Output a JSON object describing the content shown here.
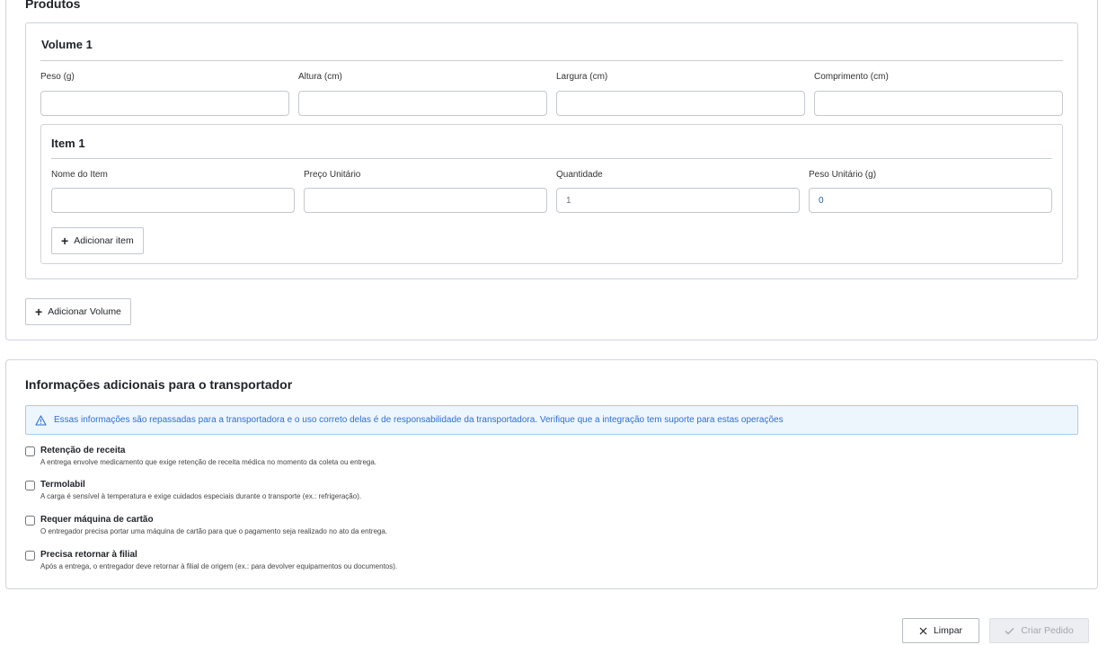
{
  "produtos": {
    "title": "Produtos",
    "volume": {
      "title": "Volume 1",
      "fields": [
        {
          "label": "Peso (g)",
          "value": ""
        },
        {
          "label": "Altura (cm)",
          "value": ""
        },
        {
          "label": "Largura (cm)",
          "value": ""
        },
        {
          "label": "Comprimento (cm)",
          "value": ""
        }
      ],
      "item": {
        "title": "Item 1",
        "fields": [
          {
            "label": "Nome do Item",
            "value": ""
          },
          {
            "label": "Preço Unitário",
            "value": ""
          },
          {
            "label": "Quantidade",
            "value": "1"
          },
          {
            "label": "Peso Unitário (g)",
            "value": "0"
          }
        ],
        "add_item_label": "Adicionar item"
      }
    },
    "add_volume_label": "Adicionar Volume"
  },
  "info": {
    "title": "Informações adicionais para o transportador",
    "alert_text": "Essas informações são repassadas para a transportadora e o uso correto delas é de responsabilidade da transportadora. Verifique que a integração tem suporte para estas operações",
    "options": [
      {
        "title": "Retenção de receita",
        "description": "A entrega envolve medicamento que exige retenção de receita médica no momento da coleta ou entrega.",
        "checked": false
      },
      {
        "title": "Termolabil",
        "description": "A carga é sensível à temperatura e exige cuidados especiais durante o transporte (ex.: refrigeração).",
        "checked": false
      },
      {
        "title": "Requer máquina de cartão",
        "description": "O entregador precisa portar uma máquina de cartão para que o pagamento seja realizado no ato da entrega.",
        "checked": false
      },
      {
        "title": "Precisa retornar à filial",
        "description": "Após a entrega, o entregador deve retornar à filial de origem (ex.: para devolver equipamentos ou documentos).",
        "checked": false
      }
    ]
  },
  "footer": {
    "clear_label": "Limpar",
    "submit_label": "Criar Pedido",
    "submit_disabled": true
  },
  "colors": {
    "accent": "#2f6fd1",
    "border": "#d0d4d9",
    "alert_bg": "#eef6fd",
    "disabled_bg": "#eceef1"
  }
}
